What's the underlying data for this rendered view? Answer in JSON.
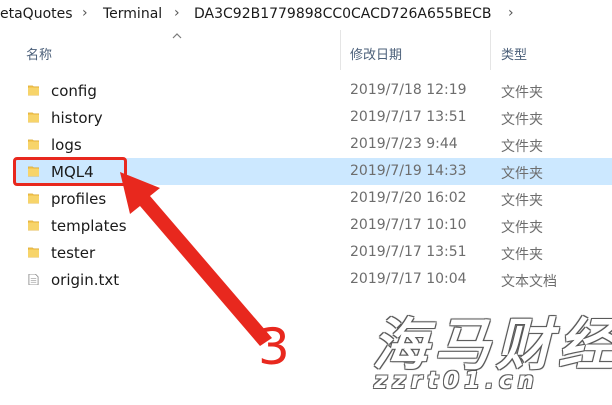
{
  "breadcrumb": {
    "items": [
      "etaQuotes",
      "Terminal",
      "DA3C92B1779898CC0CACD726A655BECB"
    ]
  },
  "columns": {
    "name": "名称",
    "date": "修改日期",
    "type": "类型"
  },
  "files": [
    {
      "name": "config",
      "date": "2019/7/18 12:19",
      "type": "文件夹",
      "icon": "folder-icon"
    },
    {
      "name": "history",
      "date": "2019/7/17 13:51",
      "type": "文件夹",
      "icon": "folder-icon"
    },
    {
      "name": "logs",
      "date": "2019/7/23 9:44",
      "type": "文件夹",
      "icon": "folder-icon"
    },
    {
      "name": "MQL4",
      "date": "2019/7/19 14:33",
      "type": "文件夹",
      "icon": "folder-icon",
      "selected": true
    },
    {
      "name": "profiles",
      "date": "2019/7/20 16:02",
      "type": "文件夹",
      "icon": "folder-icon"
    },
    {
      "name": "templates",
      "date": "2019/7/17 10:10",
      "type": "文件夹",
      "icon": "folder-icon"
    },
    {
      "name": "tester",
      "date": "2019/7/17 13:51",
      "type": "文件夹",
      "icon": "folder-icon"
    },
    {
      "name": "origin.txt",
      "date": "2019/7/17 10:04",
      "type": "文本文档",
      "icon": "text-file-icon"
    }
  ],
  "annotation": {
    "step_number": "3",
    "color": "#e8281e"
  },
  "watermark": {
    "brand": "海马财经",
    "url": "zzrt01.cn"
  },
  "colors": {
    "selected_row": "#cce8ff",
    "folder": "#f2c44d",
    "header_text": "#4c607a"
  }
}
